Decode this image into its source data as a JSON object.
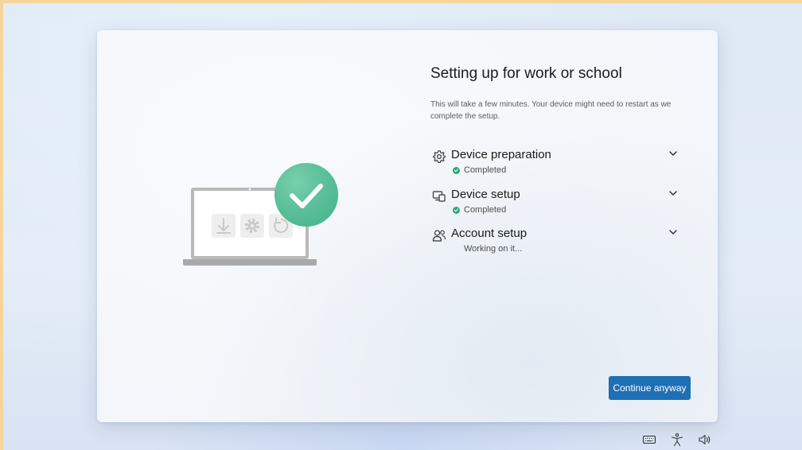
{
  "setup": {
    "title": "Setting up for work or school",
    "description": "This will take a few minutes. Your device might need to restart as we complete the setup.",
    "steps": [
      {
        "name": "Device preparation",
        "status": "Completed",
        "icon": "gear-icon",
        "state": "completed"
      },
      {
        "name": "Device setup",
        "status": "Completed",
        "icon": "devices-icon",
        "state": "completed"
      },
      {
        "name": "Account setup",
        "status": "Working on it...",
        "icon": "people-icon",
        "state": "in-progress"
      }
    ],
    "continue_label": "Continue anyway"
  },
  "illustration": {
    "icons": [
      "download-icon",
      "settings-icon",
      "refresh-icon",
      "checkmark-icon"
    ]
  },
  "tray": {
    "icons": [
      "keyboard-icon",
      "accessibility-icon",
      "volume-icon"
    ]
  },
  "colors": {
    "accent": "#1f6fb5",
    "success": "#2ea67c",
    "check_badge": "#5cc29a"
  }
}
